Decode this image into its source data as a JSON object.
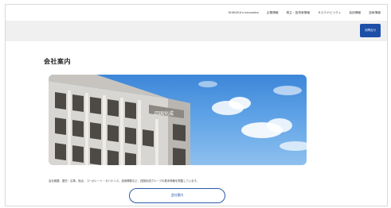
{
  "nav": {
    "items": [
      "SHIKOKU's Innovation",
      "企業情報",
      "株主・投資家情報",
      "サステナビリティ",
      "採用情報",
      "技術情報"
    ]
  },
  "header": {
    "cta_label": "お問合せ"
  },
  "page": {
    "title": "会社案内",
    "description": "会社概要、歴史・沿革、拠点、コーポレート・ガバナンス、技術開発など、四国化成グループの基本情報を掲載しています。",
    "button_label": "会社案内"
  },
  "hero": {
    "building_sign": "四国化成",
    "sky_color": "#4f94df"
  }
}
